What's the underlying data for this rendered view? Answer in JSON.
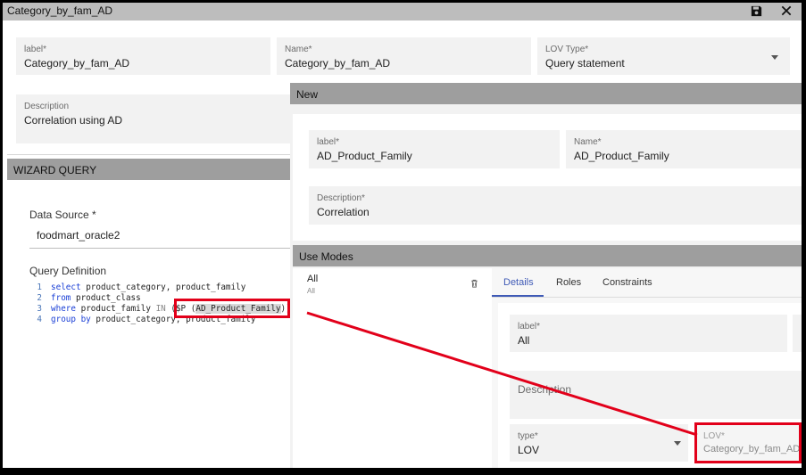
{
  "window": {
    "title": "Category_by_fam_AD"
  },
  "icons": {
    "save": "save-icon",
    "close": "close-icon",
    "dropdown": "chevron-down-icon",
    "delete": "trash-icon"
  },
  "top_fields": {
    "label": {
      "label": "label*",
      "value": "Category_by_fam_AD"
    },
    "name": {
      "label": "Name*",
      "value": "Category_by_fam_AD"
    },
    "lov_type": {
      "label": "LOV Type*",
      "value": "Query statement"
    },
    "description": {
      "label": "Description",
      "value": "Correlation using AD"
    }
  },
  "wizard": {
    "title": "WIZARD QUERY",
    "data_source_label": "Data Source *",
    "data_source_value": "foodmart_oracle2",
    "query_definition_label": "Query Definition",
    "code_lines": [
      {
        "num": "1",
        "kw1": "select",
        "rest": " product_category, product_family"
      },
      {
        "num": "2",
        "kw1": "from",
        "rest": " product_class"
      },
      {
        "num": "3",
        "kw1": "where",
        "rest": " product_family ",
        "op": "IN",
        "p1": " ($P (",
        "hl": "AD_Product_Family",
        "p2": "))"
      },
      {
        "num": "4",
        "kw1": "group by",
        "rest": " product_category, product_family"
      }
    ]
  },
  "new_panel": {
    "title": "New",
    "label": {
      "label": "label*",
      "value": "AD_Product_Family"
    },
    "name": {
      "label": "Name*",
      "value": "AD_Product_Family"
    },
    "description": {
      "label": "Description*",
      "value": "Correlation"
    }
  },
  "use_modes": {
    "title": "Use Modes",
    "items": [
      {
        "title": "All",
        "subtitle": "All"
      }
    ],
    "tabs": [
      "Details",
      "Roles",
      "Constraints"
    ],
    "active_tab": "Details",
    "details": {
      "label": {
        "label": "label*",
        "value": "All"
      },
      "description": {
        "label": "Description",
        "value": ""
      },
      "type": {
        "label": "type*",
        "value": "LOV"
      },
      "lov": {
        "label": "LOV*",
        "value": "Category_by_fam_AD"
      }
    }
  },
  "colors": {
    "accent": "#3f5ab6",
    "annotation": "#e2001a",
    "section_bar": "#9e9e9e"
  }
}
